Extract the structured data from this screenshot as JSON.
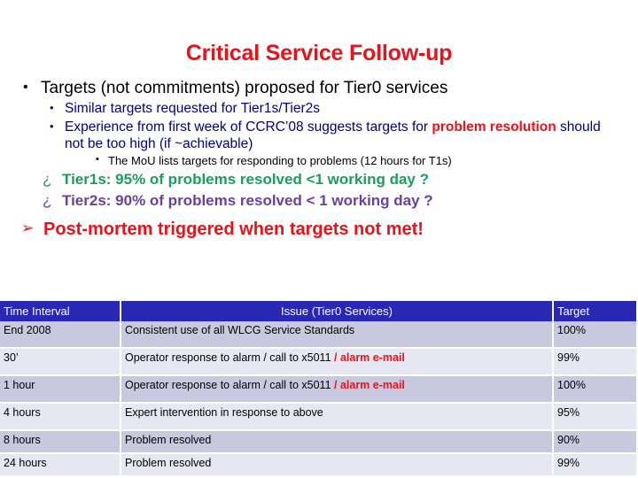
{
  "slide": {
    "title": "Critical Service Follow-up",
    "bullets": {
      "level1": {
        "mark": "•",
        "text": "Targets (not commitments) proposed for Tier0 services"
      },
      "level2": [
        {
          "mark": "•",
          "text": "Similar targets requested for Tier1s/Tier2s"
        },
        {
          "mark": "•",
          "text_part1": "Experience from first week of CCRC’08 suggests targets for ",
          "highlight": "problem resolution",
          "text_part2": " should not be too high (if ~achievable)"
        }
      ],
      "level3": {
        "mark": "•",
        "text": "The MoU lists targets for responding to problems (12 hours for T1s)"
      },
      "questions": [
        {
          "mark": "¿",
          "text": "Tier1s: 95% of problems resolved <1 working day ?",
          "color": "#1A9E5C"
        },
        {
          "mark": "¿",
          "text": "Tier2s: 90% of problems resolved < 1 working day ?",
          "color": "#6B3FA0"
        }
      ],
      "conclusion": {
        "mark": "➢",
        "text": "Post-mortem triggered when targets not met!",
        "color": "#E8131A"
      }
    },
    "table": {
      "headers": {
        "time_interval": "Time Interval",
        "issue": "Issue (Tier0 Services)",
        "target": "Target"
      },
      "rows": [
        {
          "time": "End 2008",
          "issue": "Consistent use of all WLCG Service Standards",
          "issue_red": "",
          "target": "100%"
        },
        {
          "time": "30’",
          "issue": "Operator response to alarm / call to x5011 ",
          "issue_red": "/ alarm e-mail",
          "target": "99%"
        },
        {
          "time": "1 hour",
          "issue": "Operator response to alarm / call to x5011 ",
          "issue_red": "/ alarm e-mail",
          "target": "100%"
        },
        {
          "time": "4 hours",
          "issue": "Expert intervention in response to above",
          "issue_red": "",
          "target": "95%"
        },
        {
          "time": "8 hours",
          "issue": "Problem resolved",
          "issue_red": "",
          "target": "90%"
        },
        {
          "time": "24 hours",
          "issue": "Problem resolved",
          "issue_red": "",
          "target": "99%"
        }
      ]
    },
    "colors": {
      "title_red": "#E8131A",
      "body_navy": "#000080",
      "green": "#1A9E5C",
      "purple": "#6B3FA0",
      "table_header_blue": "#2828B4",
      "row_dark": "#C8C8DE",
      "row_light": "#E7E7F2"
    }
  }
}
